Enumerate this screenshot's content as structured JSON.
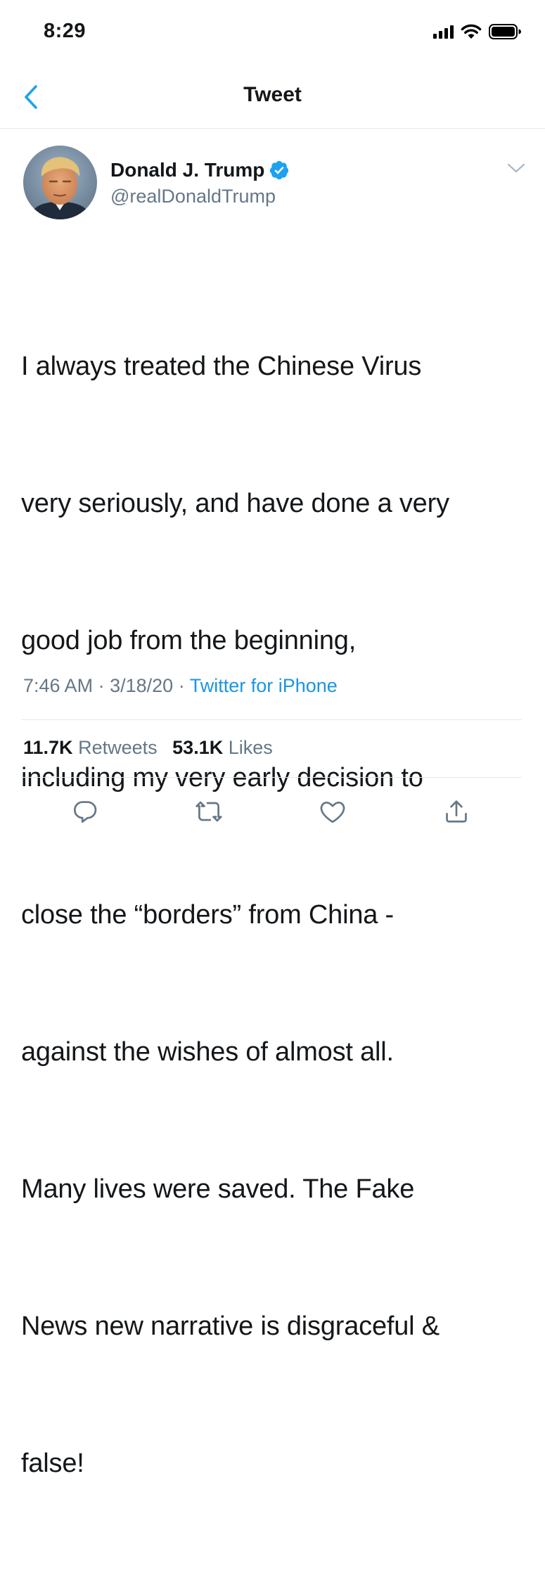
{
  "status_bar": {
    "time": "8:29"
  },
  "nav": {
    "title": "Tweet",
    "back_icon": "chevron-left-icon"
  },
  "tweet": {
    "author_name": "Donald J. Trump",
    "verified": true,
    "handle": "@realDonaldTrump",
    "text_lines": [
      "I always treated the Chinese Virus",
      "very seriously, and have done a very",
      "good job from the beginning,",
      "including my very early decision to",
      "close the “borders” from China -",
      "against the wishes of almost all.",
      "Many lives were saved. The Fake",
      "News new narrative is disgraceful &",
      "false!"
    ],
    "time": "7:46 AM",
    "separator": "·",
    "date": "3/18/20",
    "source": "Twitter for iPhone",
    "retweets_count": "11.7K",
    "retweets_label": "Retweets",
    "likes_count": "53.1K",
    "likes_label": "Likes"
  },
  "colors": {
    "accent": "#1da1f2",
    "link": "#1b95e0",
    "secondary_text": "#657786",
    "divider": "#e1e8ed"
  }
}
